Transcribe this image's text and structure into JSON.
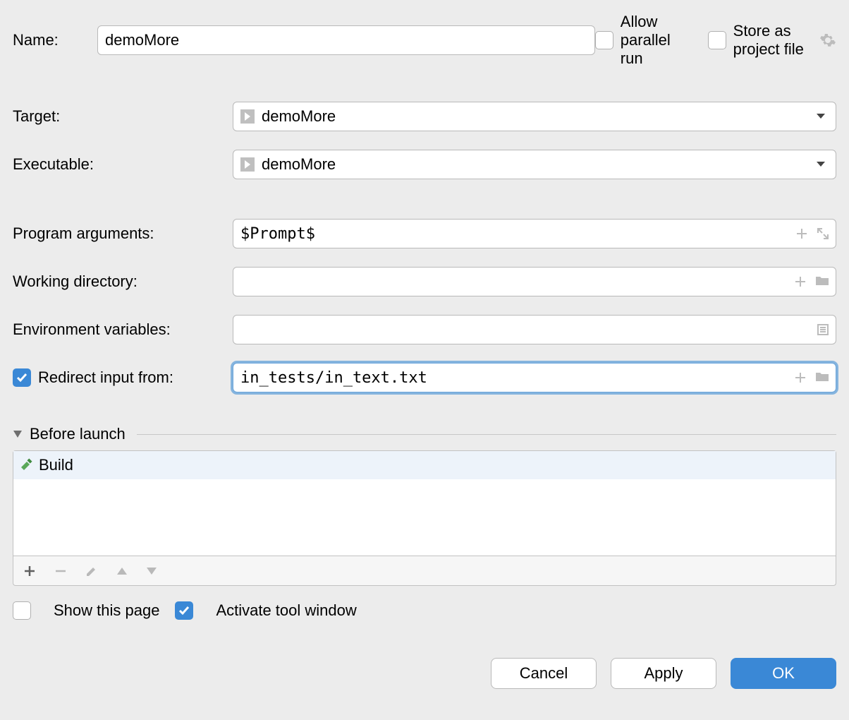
{
  "labels": {
    "name": "Name:",
    "allow_parallel": "Allow parallel run",
    "store_as_project": "Store as project file",
    "target": "Target:",
    "executable": "Executable:",
    "program_args": "Program arguments:",
    "working_dir": "Working directory:",
    "env_vars": "Environment variables:",
    "redirect_input": "Redirect input from:",
    "before_launch": "Before launch",
    "show_this_page": "Show this page",
    "activate_tool_window": "Activate tool window"
  },
  "values": {
    "name": "demoMore",
    "target": "demoMore",
    "executable": "demoMore",
    "program_args": "$Prompt$",
    "working_dir": "",
    "env_vars": "",
    "redirect_input": "in_tests/in_text.txt"
  },
  "before_launch_items": [
    {
      "label": "Build"
    }
  ],
  "buttons": {
    "cancel": "Cancel",
    "apply": "Apply",
    "ok": "OK"
  }
}
